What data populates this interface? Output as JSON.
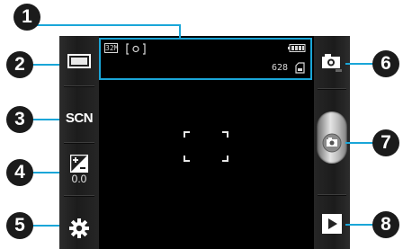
{
  "left_controls": {
    "scene_mode_label": "SCN",
    "exposure_value": "0.0"
  },
  "indicators": {
    "resolution": "32M",
    "remaining_shots": "628"
  },
  "callouts": [
    "1",
    "2",
    "3",
    "4",
    "5",
    "6",
    "7",
    "8"
  ],
  "colors": {
    "callout_line": "#1aa6d8",
    "viewfinder": "#000000",
    "callout_badge": "#1b1b1b"
  },
  "icons": {
    "shooting_mode": "rectangle-frame-icon",
    "exposure": "exposure-plus-minus-icon",
    "settings": "gear-icon",
    "switch_mode": "camera-icon",
    "shutter": "camera-shutter-icon",
    "preview": "play-icon",
    "storage": "memory-card-icon",
    "battery": "battery-icon",
    "focus": "focus-frame-icon"
  }
}
